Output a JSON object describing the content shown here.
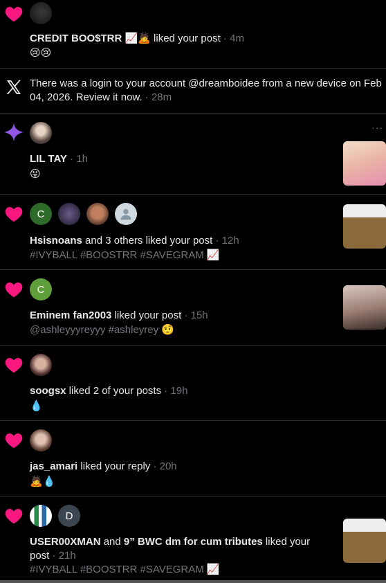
{
  "notifications": [
    {
      "type": "like",
      "user": "CREDIT BOO$TRR",
      "user_emoji": "📈🙇",
      "action": " liked your post",
      "time": " · 4m",
      "content": "😢😢"
    },
    {
      "type": "security",
      "text": "There was a login to your account @dreamboidee from a new device on Feb 04, 2026. Review it now.",
      "time": " · 28m"
    },
    {
      "type": "post",
      "user": "LIL TAY",
      "time": " · 1h",
      "content": "😝",
      "more": "···"
    },
    {
      "type": "like",
      "user": "Hsisnoans",
      "action": " and 3 others liked your post",
      "time": " · 12h",
      "content": "#IVYBALL #BOOSTRR #SAVEGRAM 📈",
      "avatar_letter": "C"
    },
    {
      "type": "like",
      "user": "Eminem fan2003",
      "action": " liked your post",
      "time": " · 15h",
      "content": "@ashleyyyreyyy #ashleyrey 🤨",
      "avatar_letter": "C"
    },
    {
      "type": "like",
      "user": "soogsx",
      "action": " liked 2 of your posts",
      "time": " · 19h",
      "content": "💧"
    },
    {
      "type": "like",
      "user": "jas_amari",
      "action": " liked your reply",
      "time": " · 20h",
      "content": "🙇💧"
    },
    {
      "type": "like",
      "user": "USER00XMAN",
      "action": " and ",
      "user2": "9” BWC dm for cum tributes",
      "action2": " liked your post",
      "time": " · 21h",
      "content": "#IVYBALL #BOOSTRR #SAVEGRAM 📈",
      "avatar_letter": "D"
    }
  ],
  "colors": {
    "like": "#f91880",
    "post_star": "#9257e5",
    "muted": "#71767b",
    "divider": "#2f3336"
  }
}
